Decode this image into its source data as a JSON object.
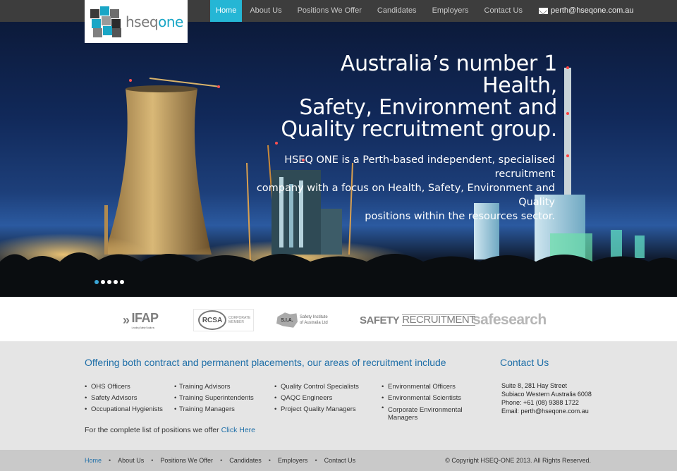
{
  "brand": {
    "logo_text_a": "hseq",
    "logo_text_b": "one"
  },
  "nav": {
    "items": [
      {
        "label": "Home",
        "active": true
      },
      {
        "label": "About Us"
      },
      {
        "label": "Positions We Offer"
      },
      {
        "label": "Candidates"
      },
      {
        "label": "Employers"
      },
      {
        "label": "Contact Us"
      }
    ],
    "email": "perth@hseqone.com.au",
    "email_icon": "mail-icon"
  },
  "hero": {
    "headline_1": "Australia’s number 1 Health,",
    "headline_2": "Safety, Environment and",
    "headline_3": "Quality recruitment group.",
    "body_1": "HSEQ ONE is a Perth-based independent, specialised recruitment",
    "body_2": "company with a focus on Health, Safety, Environment and Quality",
    "body_3": "positions within the resources sector.",
    "slides": 5,
    "active_slide": 1
  },
  "partners": {
    "ifap": "IFAP",
    "ifap_sub": "Leading Safety Solutions",
    "rcsa": "RCSA",
    "rcsa_sub_1": "CORPORATE",
    "rcsa_sub_2": "MEMBER",
    "sia": "S.I.A.",
    "sia_sub_1": "Safety Institute",
    "sia_sub_2": "of Australia Ltd",
    "safety_a": "SAFETY",
    "safety_b": "RECRUITMENT",
    "safesearch": "safesearch"
  },
  "info": {
    "heading": "Offering both contract and permanent placements, our areas of recruitment include",
    "col1": [
      "OHS Officers",
      "Safety Advisors",
      "Occupational Hygienists"
    ],
    "col2": [
      "Training Advisors",
      "Training Superintendents",
      "Training Managers"
    ],
    "col3": [
      "Quality Control Specialists",
      "QAQC Engineers",
      "Project Quality Managers"
    ],
    "col4": [
      "Environmental Officers",
      "Environmental Scientists",
      "Corporate Environmental Managers"
    ],
    "more_text": "For the complete list of positions we offer",
    "more_link": "Click Here"
  },
  "contact": {
    "heading": "Contact Us",
    "line1": "Suite 8, 281 Hay Street",
    "line2": "Subiaco Western Australia 6008",
    "line3": "Phone: +61 (08) 9388 1722",
    "line4": "Email: perth@hseqone.com.au"
  },
  "footer": {
    "nav": [
      "Home",
      "About Us",
      "Positions We Offer",
      "Candidates",
      "Employers",
      "Contact Us"
    ],
    "copyright": "© Copyright HSEQ-ONE 2013. All Rights Reserved."
  },
  "colors": {
    "accent": "#25b6d5",
    "link": "#1f6fa8",
    "topbar": "#3d3d3d"
  }
}
